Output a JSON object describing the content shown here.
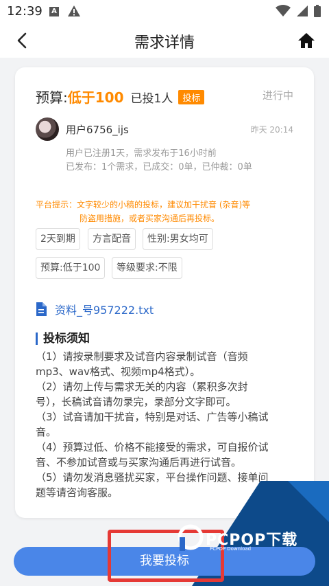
{
  "statusbar": {
    "time": "12:39",
    "a_icon_label": "A"
  },
  "nav": {
    "title": "需求详情"
  },
  "card": {
    "budget_label": "预算:",
    "budget_value": "低于100",
    "bid_count": "已投1人",
    "bid_tag": "投标",
    "status": "进行中",
    "user": {
      "name": "用户6756_ijs",
      "time": "昨天 20:14",
      "meta1": "用户已注册1天，需求发布于16小时前",
      "meta2": "已发布：1个需求，已成交：0单，已仲裁：0单"
    },
    "tip_line1": "平台提示：文字较少的小稿的投标，建议加干扰音 (杂音)等",
    "tip_line2": "防盗用措施，或者买家沟通后再投标。",
    "tags": [
      "2天到期",
      "方言配音",
      "性别:男女均可",
      "预算:低于100",
      "等级要求:不限"
    ],
    "file_name": "资料_号957222.txt",
    "notice_title": "投标须知",
    "notice_lines": [
      "（1）请按录制要求及试音内容录制试音（音频",
      "mp3、wav格式、视频mp4格式）。",
      "（2）请勿上传与需求无关的内容（累积多次封",
      "号），长稿试音请勿录完，录部分文字即可。",
      "（3）试音请加干扰音，特别是对话、广告等小稿试",
      "音。",
      "（4）预算过低、价格不能接受的需求，可自报价试",
      "音、不参加试音或与买家沟通后再进行试音。",
      "（5）请勿发消息骚扰买家，平台操作问题、接单问",
      "题等请咨询客服。"
    ]
  },
  "submit_label": "我要投标",
  "watermark": {
    "text": "PCPOP下载",
    "sub": "PCPOP Download"
  },
  "colors": {
    "accent_orange": "#ff8a00",
    "primary_blue": "#4a86e8",
    "link_blue": "#2b68c9",
    "highlight_red": "#e53935"
  }
}
